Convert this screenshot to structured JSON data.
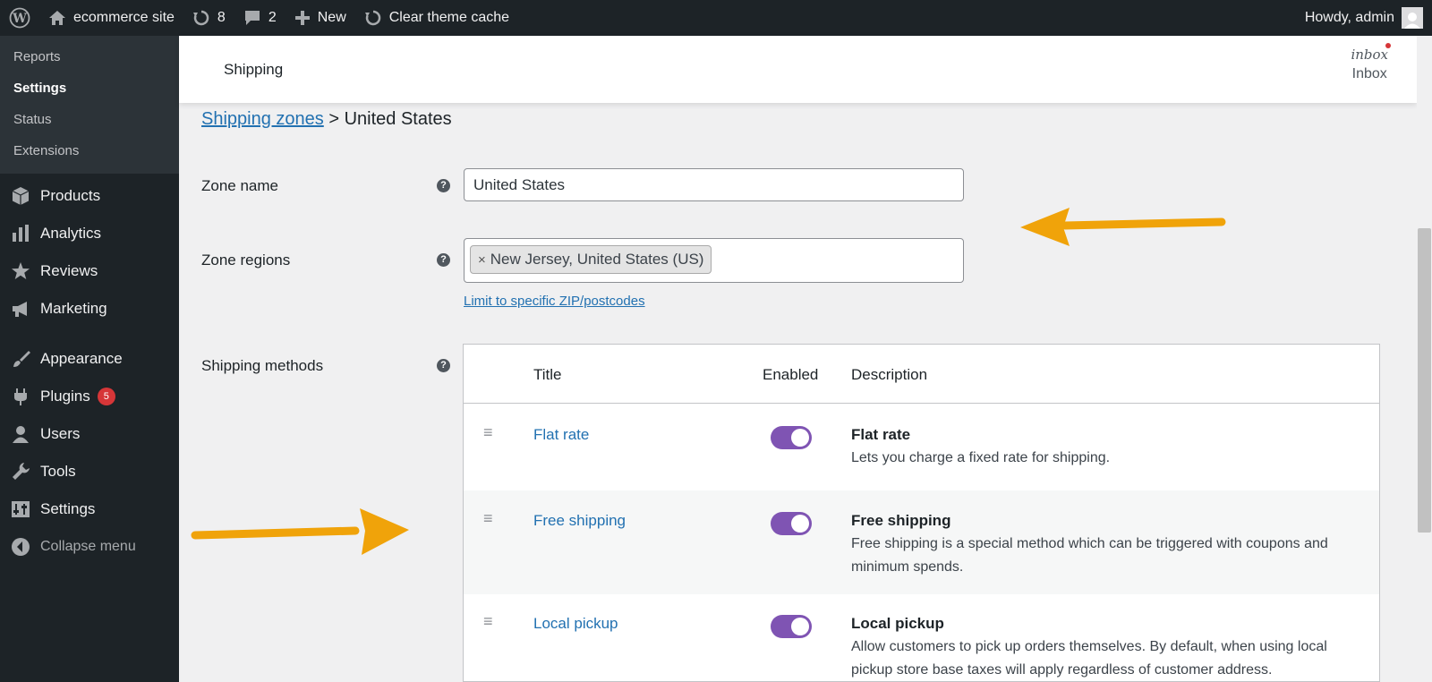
{
  "adminbar": {
    "site_name": "ecommerce site",
    "updates_count": "8",
    "comments_count": "2",
    "new_label": "New",
    "clear_cache_label": "Clear theme cache",
    "howdy": "Howdy, admin"
  },
  "sidebar": {
    "submenu": [
      {
        "label": "Reports",
        "current": false
      },
      {
        "label": "Settings",
        "current": true
      },
      {
        "label": "Status",
        "current": false
      },
      {
        "label": "Extensions",
        "current": false
      }
    ],
    "menu": [
      {
        "label": "Products",
        "icon": "box-icon"
      },
      {
        "label": "Analytics",
        "icon": "bar-chart-icon"
      },
      {
        "label": "Reviews",
        "icon": "star-icon"
      },
      {
        "label": "Marketing",
        "icon": "megaphone-icon"
      },
      {
        "label": "Appearance",
        "icon": "brush-icon"
      },
      {
        "label": "Plugins",
        "icon": "plug-icon",
        "badge": "5"
      },
      {
        "label": "Users",
        "icon": "user-icon"
      },
      {
        "label": "Tools",
        "icon": "wrench-icon"
      },
      {
        "label": "Settings",
        "icon": "settings-icon"
      }
    ],
    "collapse_label": "Collapse menu"
  },
  "header": {
    "title": "Shipping",
    "inbox_logo": "inbox",
    "inbox_label": "Inbox"
  },
  "breadcrumb": {
    "link": "Shipping zones",
    "separator": ">",
    "current": "United States"
  },
  "form": {
    "zone_name_label": "Zone name",
    "zone_name_value": "United States",
    "zone_regions_label": "Zone regions",
    "region_chip_remove": "×",
    "region_chip": "New Jersey, United States (US)",
    "limit_zip_link": "Limit to specific ZIP/postcodes",
    "shipping_methods_label": "Shipping methods",
    "help_glyph": "?"
  },
  "methods_table": {
    "headers": {
      "title": "Title",
      "enabled": "Enabled",
      "description": "Description"
    },
    "rows": [
      {
        "title": "Flat rate",
        "enabled": true,
        "desc_title": "Flat rate",
        "desc": "Lets you charge a fixed rate for shipping."
      },
      {
        "title": "Free shipping",
        "enabled": true,
        "desc_title": "Free shipping",
        "desc": "Free shipping is a special method which can be triggered with coupons and minimum spends."
      },
      {
        "title": "Local pickup",
        "enabled": true,
        "desc_title": "Local pickup",
        "desc": "Allow customers to pick up orders themselves. By default, when using local pickup store base taxes will apply regardless of customer address."
      }
    ]
  },
  "colors": {
    "adminbar_bg": "#1d2327",
    "link": "#2271b1",
    "toggle_on": "#7f54b3",
    "arrow": "#f0a30a",
    "badge": "#d63638"
  }
}
